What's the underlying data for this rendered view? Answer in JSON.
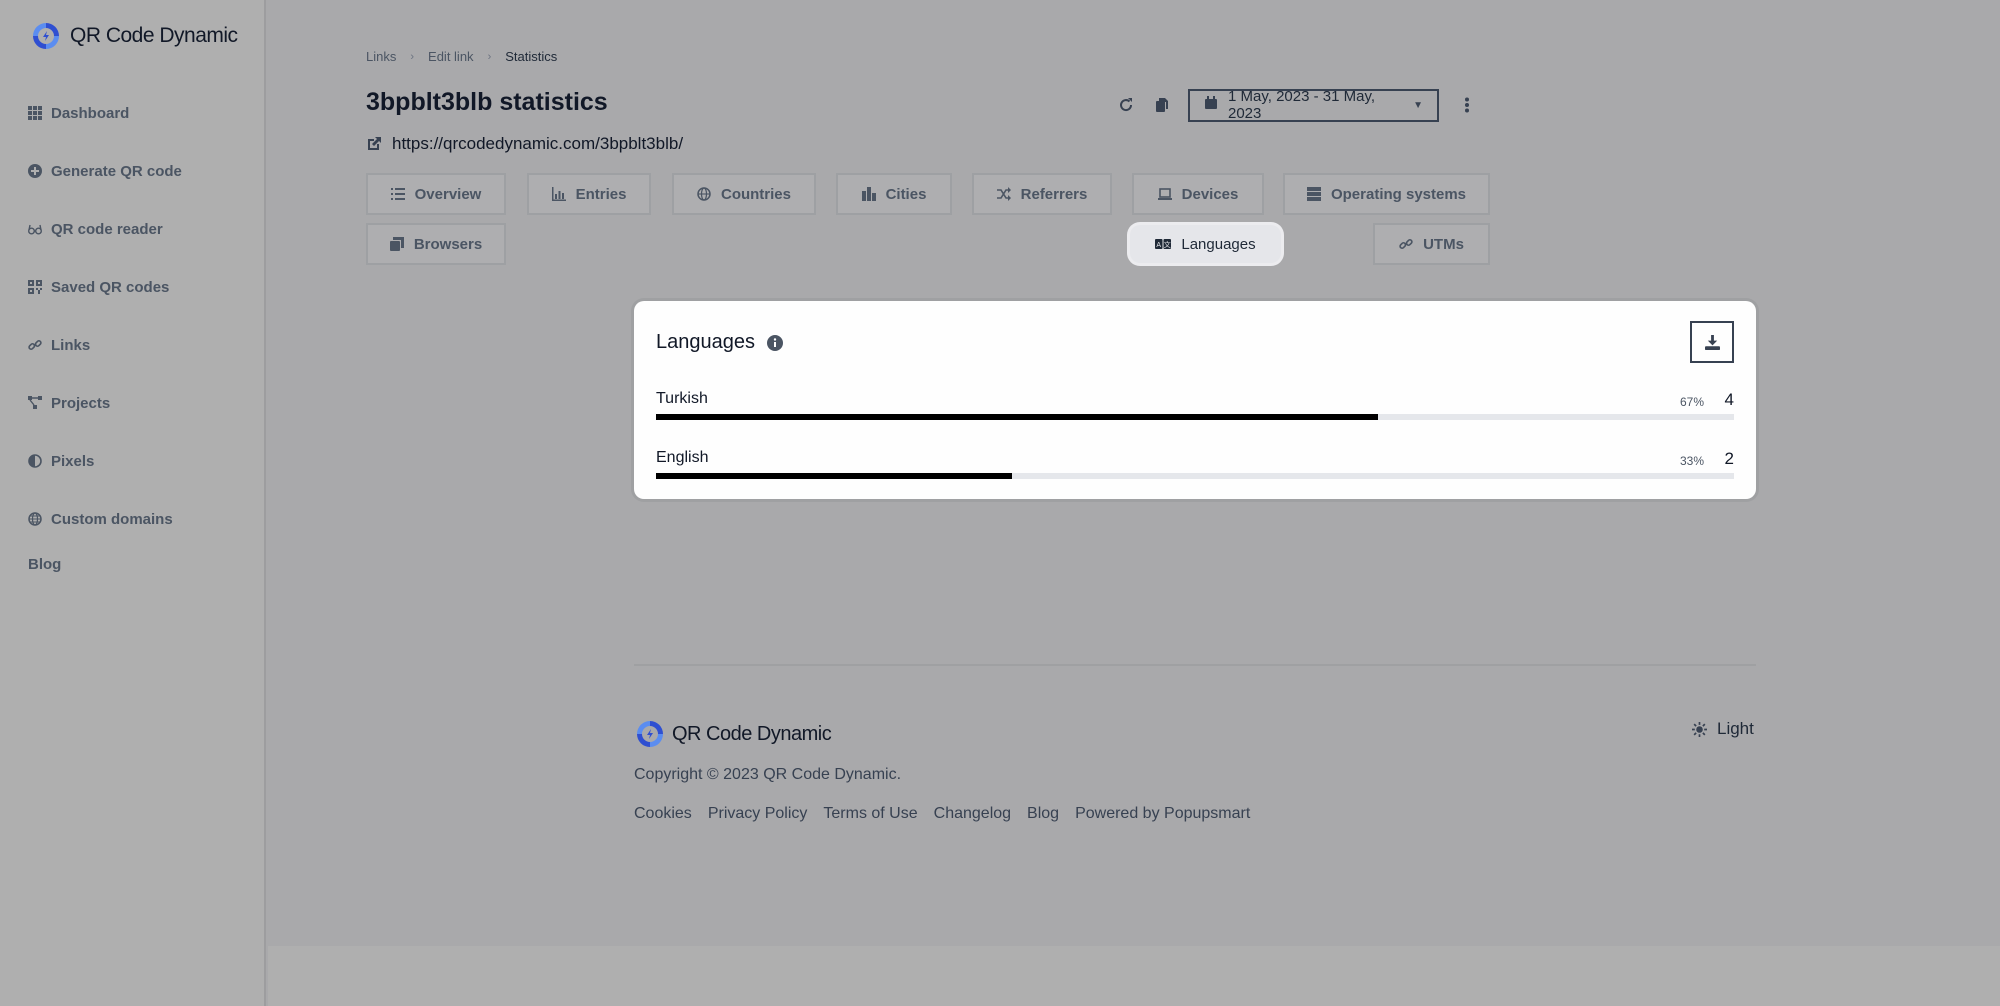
{
  "brand": {
    "name": "QR Code Dynamic",
    "colors": {
      "primary": "#2f4fd1",
      "secondary": "#5b8df0"
    }
  },
  "sidebar": {
    "items": [
      {
        "label": "Dashboard",
        "icon": "grid-icon"
      },
      {
        "label": "Generate QR code",
        "icon": "plus-circle-icon"
      },
      {
        "label": "QR code reader",
        "icon": "glasses-icon"
      },
      {
        "label": "Saved QR codes",
        "icon": "qrcode-icon"
      },
      {
        "label": "Links",
        "icon": "link-icon"
      },
      {
        "label": "Projects",
        "icon": "sitemap-icon"
      },
      {
        "label": "Pixels",
        "icon": "half-circle-icon"
      },
      {
        "label": "Custom domains",
        "icon": "globe-icon"
      }
    ],
    "blog_label": "Blog"
  },
  "breadcrumb": {
    "items": [
      "Links",
      "Edit link",
      "Statistics"
    ],
    "separator": "›"
  },
  "header": {
    "title": "3bpblt3blb statistics",
    "url": "https://qrcodedynamic.com/3bpblt3blb/",
    "date_range": "1 May, 2023 - 31 May, 2023"
  },
  "tabs": [
    {
      "label": "Overview",
      "icon": "list-icon"
    },
    {
      "label": "Entries",
      "icon": "chart-bar-icon"
    },
    {
      "label": "Countries",
      "icon": "globe-icon"
    },
    {
      "label": "Cities",
      "icon": "city-icon"
    },
    {
      "label": "Referrers",
      "icon": "random-icon"
    },
    {
      "label": "Devices",
      "icon": "laptop-icon"
    },
    {
      "label": "Operating systems",
      "icon": "server-icon"
    },
    {
      "label": "Browsers",
      "icon": "window-restore-icon"
    },
    {
      "label": "Languages",
      "icon": "language-icon",
      "active": true
    },
    {
      "label": "UTMs",
      "icon": "link-icon"
    }
  ],
  "card": {
    "title": "Languages",
    "rows": [
      {
        "name": "Turkish",
        "percent_label": "67%",
        "count": "4",
        "fraction": 0.67
      },
      {
        "name": "English",
        "percent_label": "33%",
        "count": "2",
        "fraction": 0.33
      }
    ]
  },
  "footer": {
    "brand": "QR Code Dynamic",
    "copyright": "Copyright © 2023 QR Code Dynamic.",
    "links": [
      "Cookies",
      "Privacy Policy",
      "Terms of Use",
      "Changelog",
      "Blog",
      "Powered by Popupsmart"
    ],
    "theme_label": "Light"
  }
}
